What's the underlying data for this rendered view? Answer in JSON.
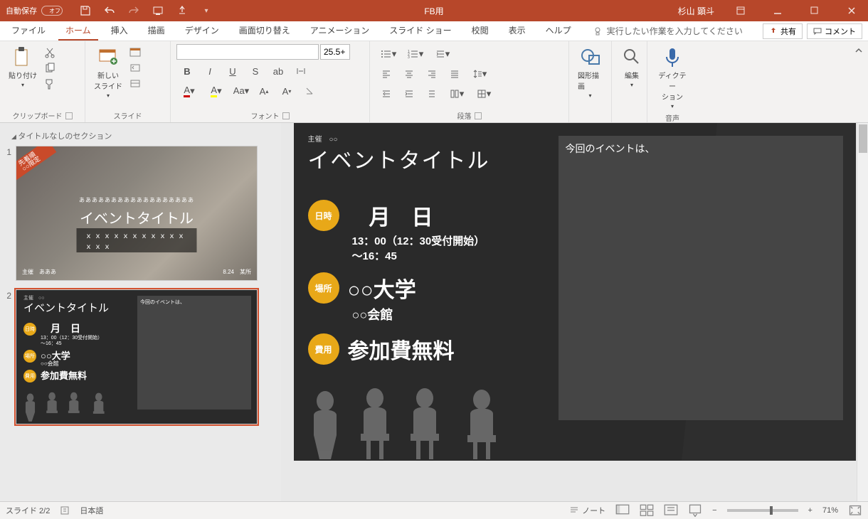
{
  "titlebar": {
    "autosave_label": "自動保存",
    "autosave_state": "オフ",
    "app_title": "FB用",
    "username": "杉山 顕斗"
  },
  "tabs": {
    "file": "ファイル",
    "home": "ホーム",
    "insert": "挿入",
    "draw": "描画",
    "design": "デザイン",
    "transitions": "画面切り替え",
    "animations": "アニメーション",
    "slideshow": "スライド ショー",
    "review": "校閲",
    "view": "表示",
    "help": "ヘルプ",
    "tellme": "実行したい作業を入力してください",
    "share": "共有",
    "comments": "コメント"
  },
  "ribbon": {
    "clipboard": {
      "paste": "貼り付け",
      "label": "クリップボード"
    },
    "slides": {
      "newslide": "新しい\nスライド",
      "label": "スライド"
    },
    "font": {
      "name": "",
      "size": "25.5+",
      "bold": "B",
      "italic": "I",
      "underline": "U",
      "strike": "S",
      "label": "フォント"
    },
    "paragraph": {
      "label": "段落"
    },
    "drawing": {
      "label": "図形描画"
    },
    "editing": {
      "label": "編集"
    },
    "voice": {
      "dictation": "ディクテー\nション",
      "label": "音声"
    }
  },
  "thumbnails": {
    "section": "タイトルなしのセクション",
    "slide1": {
      "num": "1",
      "tag": "先着順\n○○限定",
      "sub": "ああああああああああああああああああ",
      "title": "イベントタイトル",
      "bar": "ｘｘｘｘｘｘｘｘｘｘｘｘｘｘ",
      "bl": "主催　あああ",
      "br": "8.24　某所"
    },
    "slide2": {
      "num": "2"
    }
  },
  "slide": {
    "org_label": "主催",
    "org": "○○",
    "title": "イベントタイトル",
    "date_badge": "日時",
    "date_main": "　月　日",
    "date_sub1": "13：00（12：30受付開始）",
    "date_sub2": "～16：45",
    "place_badge": "場所",
    "place_main": "○○大学",
    "place_sub": "○○会館",
    "fee_badge": "費用",
    "fee_main": "参加費無料",
    "right_text": "今回のイベントは、"
  },
  "status": {
    "slide_counter": "スライド 2/2",
    "language": "日本語",
    "notes": "ノート",
    "zoom": "71%"
  }
}
